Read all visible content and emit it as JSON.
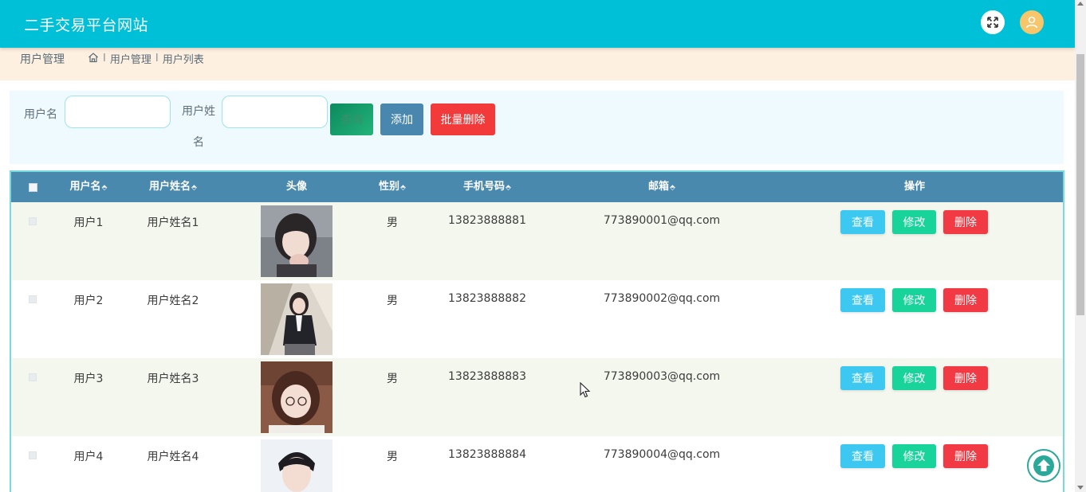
{
  "header": {
    "title": "二手交易平台网站",
    "bg_color": "#00c0d8"
  },
  "breadcrumb": {
    "section": "用户管理",
    "items": [
      "用户管理",
      "用户列表"
    ],
    "separator": "I"
  },
  "search": {
    "username_label": "用户名",
    "name_label": "用户姓名",
    "username_value": "",
    "name_value": "",
    "query_button": "查询",
    "add_button": "添加",
    "batch_delete_button": "批量删除"
  },
  "table": {
    "columns": {
      "username": "用户名",
      "name": "用户姓名",
      "avatar": "头像",
      "gender": "性别",
      "phone": "手机号码",
      "email": "邮箱",
      "actions": "操作"
    },
    "sort_icon": "⬘",
    "rows": [
      {
        "username": "用户1",
        "name": "用户姓名1",
        "gender": "男",
        "phone": "13823888881",
        "email": "773890001@qq.com"
      },
      {
        "username": "用户2",
        "name": "用户姓名2",
        "gender": "男",
        "phone": "13823888882",
        "email": "773890002@qq.com"
      },
      {
        "username": "用户3",
        "name": "用户姓名3",
        "gender": "男",
        "phone": "13823888883",
        "email": "773890003@qq.com"
      },
      {
        "username": "用户4",
        "name": "用户姓名4",
        "gender": "男",
        "phone": "13823888884",
        "email": "773890004@qq.com"
      }
    ],
    "actions": {
      "view": "查看",
      "edit": "修改",
      "delete": "删除"
    }
  },
  "colors": {
    "header_bg": "#00c0d8",
    "table_header": "#4a89ae",
    "view_btn": "#3cc8f0",
    "edit_btn": "#18d49a",
    "delete_btn": "#f23a44"
  }
}
